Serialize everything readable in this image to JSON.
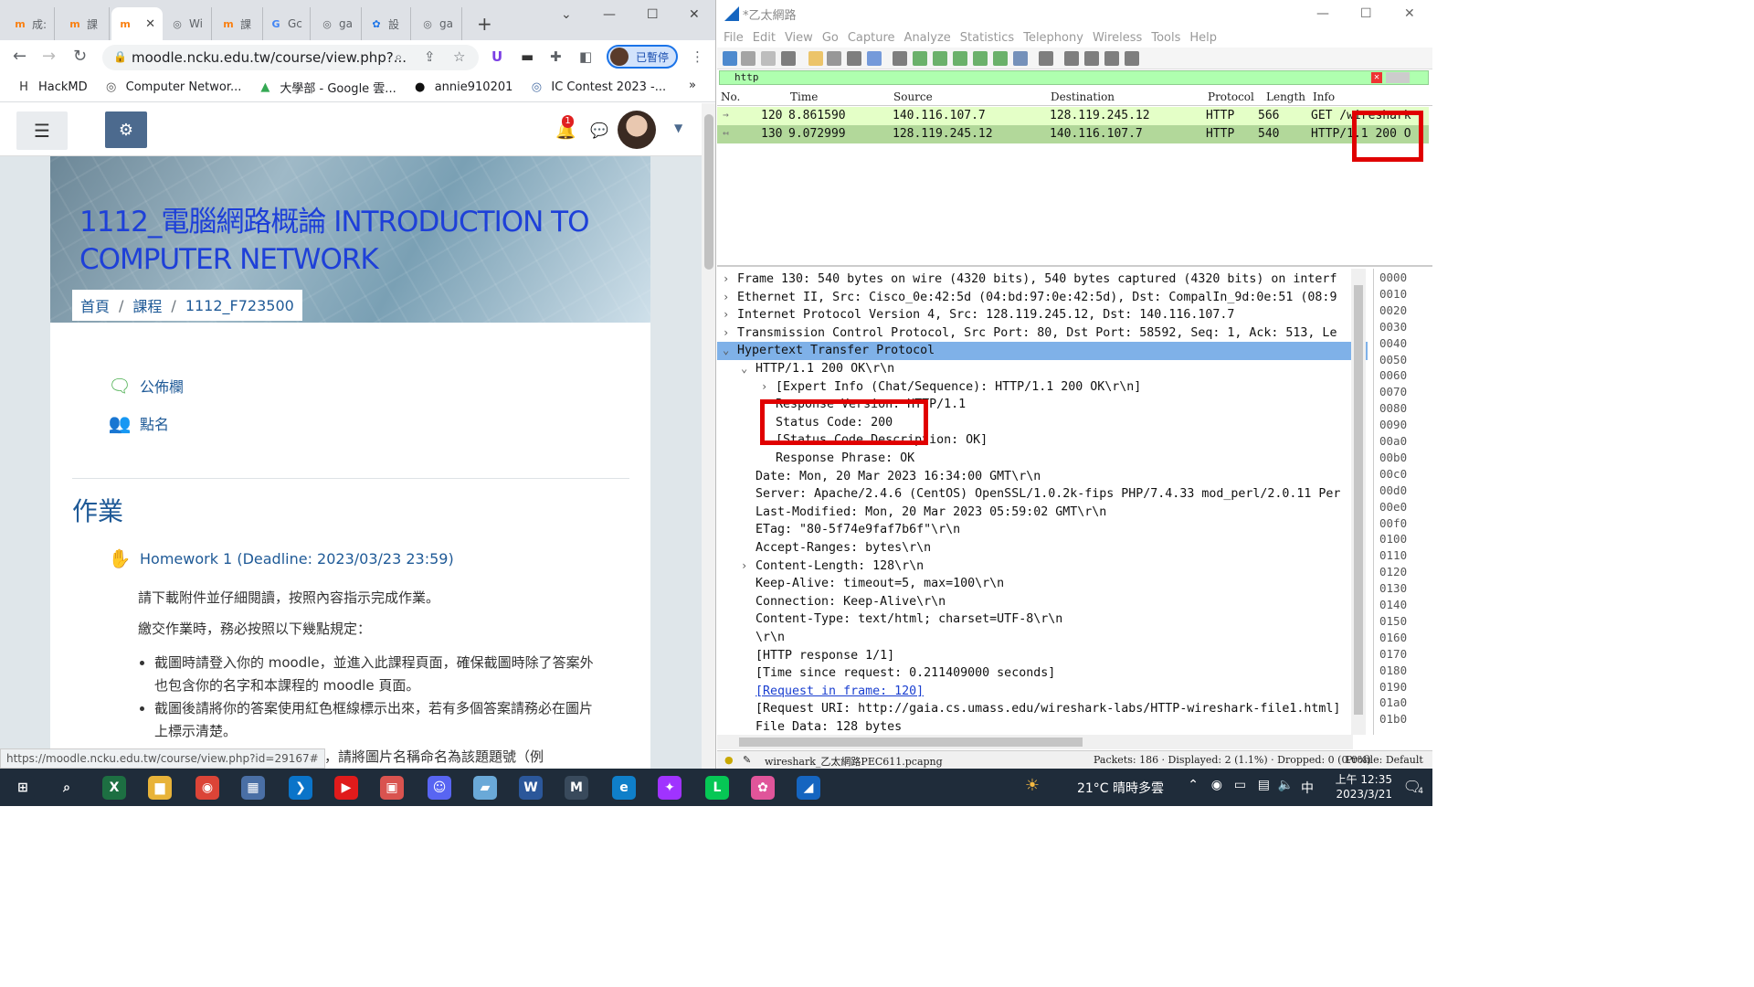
{
  "chrome": {
    "tabs": [
      {
        "icon": "moodle-icon",
        "label": "成:",
        "color": "#f98012"
      },
      {
        "icon": "moodle-icon",
        "label": "課",
        "color": "#f98012"
      },
      {
        "icon": "moodle-icon",
        "label": "",
        "color": "#f98012"
      },
      {
        "icon": "globe-icon",
        "label": "Wi",
        "color": "#5f6368"
      },
      {
        "icon": "moodle-icon",
        "label": "課",
        "color": "#f98012"
      },
      {
        "icon": "translate-icon",
        "label": "Gc",
        "color": "#4285f4"
      },
      {
        "icon": "globe-icon",
        "label": "ga",
        "color": "#5f6368"
      },
      {
        "icon": "gear-icon",
        "label": "設",
        "color": "#1a73e8"
      },
      {
        "icon": "globe-icon",
        "label": "ga",
        "color": "#5f6368"
      }
    ],
    "new_tab": "+",
    "url": "moodle.ncku.edu.tw/course/view.php?...",
    "profile_label": "已暫停",
    "bookmarks": [
      {
        "icon": "hackmd-icon",
        "label": "HackMD"
      },
      {
        "icon": "globe-icon",
        "label": "Computer Networ..."
      },
      {
        "icon": "google-drive-icon",
        "label": "大學部 - Google 雲..."
      },
      {
        "icon": "github-icon",
        "label": "annie910201"
      },
      {
        "icon": "contest-icon",
        "label": "IC Contest 2023 -..."
      }
    ],
    "bookmarks_more": "»",
    "status_url": "https://moodle.ncku.edu.tw/course/view.php?id=29167#"
  },
  "moodle": {
    "notification_count": "1",
    "course_title": "1112_電腦網路概論 INTRODUCTION TO COMPUTER NETWORK",
    "breadcrumb": [
      "首頁",
      "課程",
      "1112_F723500"
    ],
    "activities": [
      {
        "icon": "forum-icon",
        "label": "公佈欄"
      },
      {
        "icon": "attendance-icon",
        "label": "點名"
      }
    ],
    "section_title": "作業",
    "assignment": "Homework 1 (Deadline: 2023/03/23 23:59)",
    "para1": "請下載附件並仔細閱讀，按照內容指示完成作業。",
    "para2": "繳交作業時，務必按照以下幾點規定：",
    "rules": [
      "截圖時請登入你的 moodle，並進入此課程頁面，確保截圖時除了答案外也包含你的名字和本課程的 moodle 頁面。",
      "截圖後請將你的答案使用紅色框線標示出來，若有多個答案請務必在圖片上標示清楚。"
    ],
    "tail_text": "片，請將圖片名稱命名為該題題號（例"
  },
  "wireshark": {
    "title": "*乙太網路",
    "menu": [
      "File",
      "Edit",
      "View",
      "Go",
      "Capture",
      "Analyze",
      "Statistics",
      "Telephony",
      "Wireless",
      "Tools",
      "Help"
    ],
    "filter": "http",
    "columns": [
      "No.",
      "Time",
      "Source",
      "Destination",
      "Protocol",
      "Length",
      "Info"
    ],
    "packets": [
      {
        "no": "120",
        "time": "8.861590",
        "src": "140.116.107.7",
        "dst": "128.119.245.12",
        "proto": "HTTP",
        "len": "566",
        "info": "GET /wireshark"
      },
      {
        "no": "130",
        "time": "9.072999",
        "src": "128.119.245.12",
        "dst": "140.116.107.7",
        "proto": "HTTP",
        "len": "540",
        "info": "HTTP/1.1 200 O"
      }
    ],
    "details": [
      {
        "exp": ">",
        "indent": 0,
        "text": "Frame 130: 540 bytes on wire (4320 bits), 540 bytes captured (4320 bits) on interf"
      },
      {
        "exp": ">",
        "indent": 0,
        "text": "Ethernet II, Src: Cisco_0e:42:5d (04:bd:97:0e:42:5d), Dst: CompalIn_9d:0e:51 (08:9"
      },
      {
        "exp": ">",
        "indent": 0,
        "text": "Internet Protocol Version 4, Src: 128.119.245.12, Dst: 140.116.107.7"
      },
      {
        "exp": ">",
        "indent": 0,
        "text": "Transmission Control Protocol, Src Port: 80, Dst Port: 58592, Seq: 1, Ack: 513, Le"
      },
      {
        "exp": "v",
        "indent": 0,
        "text": "Hypertext Transfer Protocol",
        "selected": true
      },
      {
        "exp": "v",
        "indent": 1,
        "text": "HTTP/1.1 200 OK\\r\\n"
      },
      {
        "exp": ">",
        "indent": 2,
        "text": "[Expert Info (Chat/Sequence): HTTP/1.1 200 OK\\r\\n]"
      },
      {
        "exp": "",
        "indent": 2,
        "text": "Response Version: HTTP/1.1"
      },
      {
        "exp": "",
        "indent": 2,
        "text": "Status Code: 200"
      },
      {
        "exp": "",
        "indent": 2,
        "text": "[Status Code Description: OK]"
      },
      {
        "exp": "",
        "indent": 2,
        "text": "Response Phrase: OK"
      },
      {
        "exp": "",
        "indent": 1,
        "text": "Date: Mon, 20 Mar 2023 16:34:00 GMT\\r\\n"
      },
      {
        "exp": "",
        "indent": 1,
        "text": "Server: Apache/2.4.6 (CentOS) OpenSSL/1.0.2k-fips PHP/7.4.33 mod_perl/2.0.11 Per"
      },
      {
        "exp": "",
        "indent": 1,
        "text": "Last-Modified: Mon, 20 Mar 2023 05:59:02 GMT\\r\\n"
      },
      {
        "exp": "",
        "indent": 1,
        "text": "ETag: \"80-5f74e9faf7b6f\"\\r\\n"
      },
      {
        "exp": "",
        "indent": 1,
        "text": "Accept-Ranges: bytes\\r\\n"
      },
      {
        "exp": ">",
        "indent": 1,
        "text": "Content-Length: 128\\r\\n"
      },
      {
        "exp": "",
        "indent": 1,
        "text": "Keep-Alive: timeout=5, max=100\\r\\n"
      },
      {
        "exp": "",
        "indent": 1,
        "text": "Connection: Keep-Alive\\r\\n"
      },
      {
        "exp": "",
        "indent": 1,
        "text": "Content-Type: text/html; charset=UTF-8\\r\\n"
      },
      {
        "exp": "",
        "indent": 1,
        "text": "\\r\\n"
      },
      {
        "exp": "",
        "indent": 1,
        "text": "[HTTP response 1/1]"
      },
      {
        "exp": "",
        "indent": 1,
        "text": "[Time since request: 0.211409000 seconds]"
      },
      {
        "exp": "",
        "indent": 1,
        "text": "[Request in frame: 120]",
        "link": true
      },
      {
        "exp": "",
        "indent": 1,
        "text": "[Request URI: http://gaia.cs.umass.edu/wireshark-labs/HTTP-wireshark-file1.html]"
      },
      {
        "exp": "",
        "indent": 1,
        "text": "File Data: 128 bytes"
      }
    ],
    "hex_offsets": [
      "0000",
      "0010",
      "0020",
      "0030",
      "0040",
      "0050",
      "0060",
      "0070",
      "0080",
      "0090",
      "00a0",
      "00b0",
      "00c0",
      "00d0",
      "00e0",
      "00f0",
      "0100",
      "0110",
      "0120",
      "0130",
      "0140",
      "0150",
      "0160",
      "0170",
      "0180",
      "0190",
      "01a0",
      "01b0"
    ],
    "status_file": "wireshark_乙太網路PEC611.pcapng",
    "status_packets": "Packets: 186 · Displayed: 2 (1.1%) · Dropped: 0 (0.0%)",
    "status_profile": "Profile: Default"
  },
  "taskbar": {
    "apps": [
      {
        "icon": "windows-start-icon",
        "color": "#1f2c3a"
      },
      {
        "icon": "search-icon",
        "color": "#1f2c3a"
      },
      {
        "icon": "excel-icon",
        "color": "#1d6f42"
      },
      {
        "icon": "file-explorer-icon",
        "color": "#e8b339"
      },
      {
        "icon": "chrome-icon",
        "color": "#db4437"
      },
      {
        "icon": "calculator-icon",
        "color": "#4a6fa5"
      },
      {
        "icon": "vscode-icon",
        "color": "#0a74c9"
      },
      {
        "icon": "media-player-icon",
        "color": "#e01b1b"
      },
      {
        "icon": "app-red-icon",
        "color": "#d9534f"
      },
      {
        "icon": "discord-icon",
        "color": "#5865f2"
      },
      {
        "icon": "notes-icon",
        "color": "#6aa9d8"
      },
      {
        "icon": "word-icon",
        "color": "#2b579a"
      },
      {
        "icon": "mplab-icon",
        "color": "#394a5c"
      },
      {
        "icon": "edge-icon",
        "color": "#0f7fc9"
      },
      {
        "icon": "messenger-icon",
        "color": "#a033ff"
      },
      {
        "icon": "line-icon",
        "color": "#06c755"
      },
      {
        "icon": "paint-icon",
        "color": "#e0559a"
      },
      {
        "icon": "wireshark-icon",
        "color": "#1565c0"
      }
    ],
    "weather": "21°C  晴時多雲",
    "ime": "中",
    "time": "上午 12:35",
    "date": "2023/3/21",
    "notif_count": "4"
  }
}
